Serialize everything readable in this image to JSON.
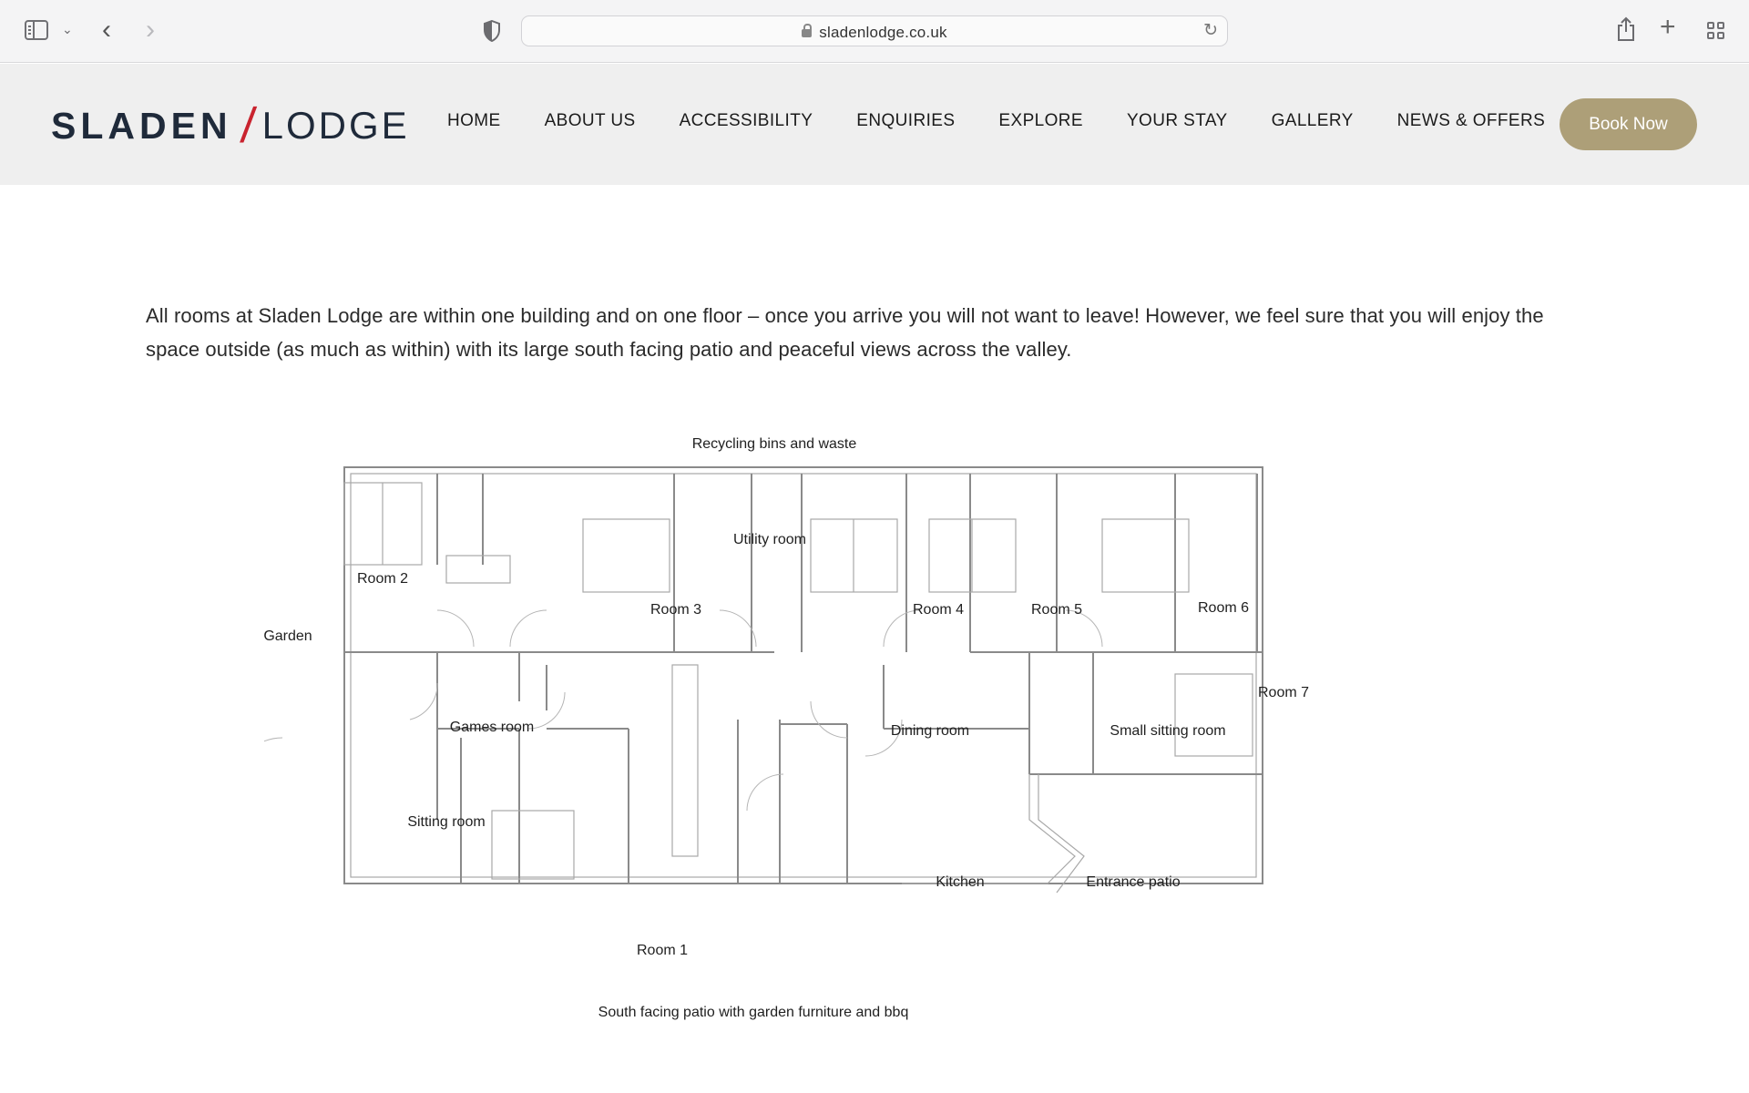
{
  "browser": {
    "url": "sladenlodge.co.uk"
  },
  "site": {
    "logo_left": "SLADEN",
    "logo_slash": "/",
    "logo_right": "LODGE",
    "nav": [
      {
        "label": "HOME"
      },
      {
        "label": "ABOUT US"
      },
      {
        "label": "ACCESSIBILITY"
      },
      {
        "label": "ENQUIRIES"
      },
      {
        "label": "EXPLORE"
      },
      {
        "label": "YOUR STAY"
      },
      {
        "label": "GALLERY"
      },
      {
        "label": "NEWS & OFFERS"
      }
    ],
    "book_button": "Book Now",
    "book_button_color": "#ad9f78",
    "logo_accent_color": "#c9232e"
  },
  "content": {
    "intro": " All rooms at Sladen Lodge are within one building and on one floor – once you arrive you will not want to leave! However, we feel sure that you will enjoy the space outside (as much as within) with its large south facing patio and peaceful views across the valley."
  },
  "floorplan": {
    "top_label": "Recycling bins and waste",
    "bottom_label": "South facing patio with garden furniture and bbq",
    "garden": "Garden",
    "rooms": {
      "room2": "Room 2",
      "room3": "Room 3",
      "utility": "Utility room",
      "room4": "Room 4",
      "room5": "Room 5",
      "room6": "Room 6",
      "room7": "Room 7",
      "games": "Games room",
      "dining": "Dining room",
      "small_sitting": "Small sitting room",
      "sitting": "Sitting room",
      "kitchen": "Kitchen",
      "entrance": "Entrance patio",
      "room1": "Room 1"
    }
  }
}
